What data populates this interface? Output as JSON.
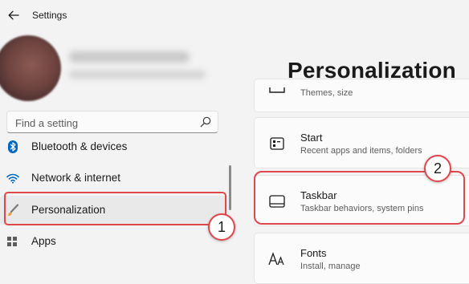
{
  "window": {
    "title": "Settings"
  },
  "search": {
    "placeholder": "Find a setting"
  },
  "sidebar": {
    "items": [
      {
        "label": "Bluetooth & devices",
        "icon": "bluetooth-icon"
      },
      {
        "label": "Network & internet",
        "icon": "wifi-icon"
      },
      {
        "label": "Personalization",
        "icon": "brush-icon",
        "selected": true
      },
      {
        "label": "Apps",
        "icon": "apps-icon"
      }
    ]
  },
  "main": {
    "title": "Personalization",
    "cards": [
      {
        "title": "",
        "subtitle": "Themes, size",
        "icon": "text-input-icon"
      },
      {
        "title": "Start",
        "subtitle": "Recent apps and items, folders",
        "icon": "start-icon"
      },
      {
        "title": "Taskbar",
        "subtitle": "Taskbar behaviors, system pins",
        "icon": "taskbar-icon"
      },
      {
        "title": "Fonts",
        "subtitle": "Install, manage",
        "icon": "fonts-icon"
      }
    ]
  },
  "annotations": [
    {
      "number": "1"
    },
    {
      "number": "2"
    }
  ],
  "colors": {
    "highlight": "#e0474c",
    "accent": "#0067c0"
  }
}
